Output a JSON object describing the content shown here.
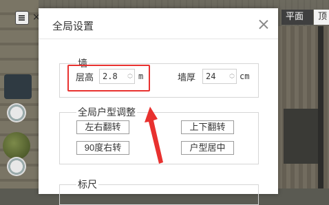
{
  "background": {
    "tabs": {
      "plan": "平面",
      "top": "顶"
    },
    "menu_x": "×"
  },
  "dialog": {
    "title": "全局设置",
    "wall": {
      "legend": "墙",
      "height_label": "层高",
      "height_value": "2.8",
      "height_unit": "m",
      "thickness_label": "墙厚",
      "thickness_value": "24",
      "thickness_unit": "cm"
    },
    "layout": {
      "legend": "全局户型调整",
      "flip_lr": "左右翻转",
      "flip_ud": "上下翻转",
      "rotate_90": "90度右转",
      "center": "户型居中"
    },
    "ruler": {
      "legend": "标尺"
    }
  },
  "annotation": {
    "color": "#e8312f"
  },
  "icons": {
    "close": "close-icon",
    "menu": "menu-icon",
    "spin_up": "chevron-up-icon",
    "spin_down": "chevron-down-icon"
  }
}
